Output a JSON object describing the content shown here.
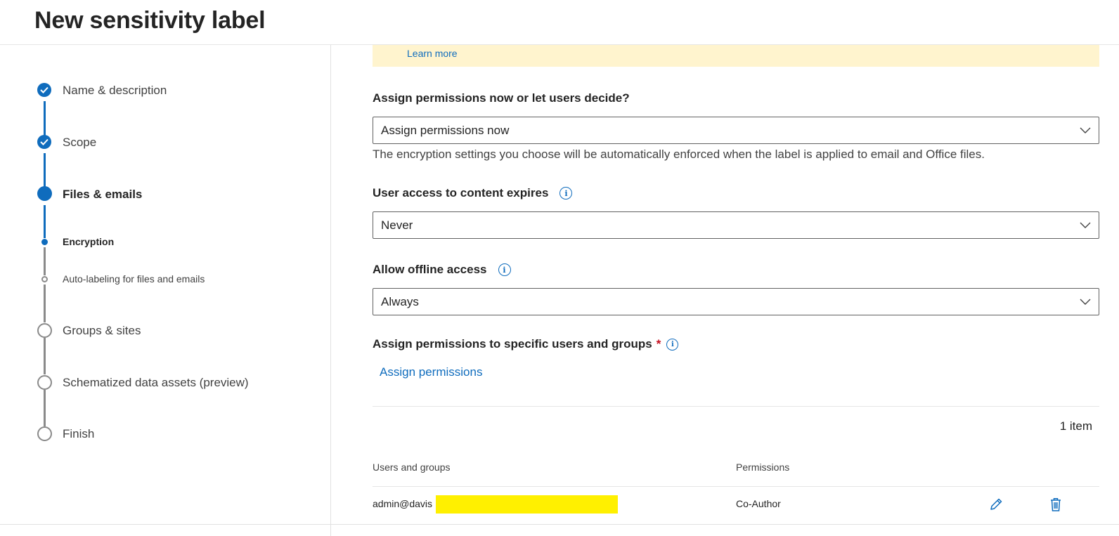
{
  "header": {
    "title": "New sensitivity label"
  },
  "steps": [
    {
      "label": "Name & description",
      "state": "completed",
      "icon": "check-icon"
    },
    {
      "label": "Scope",
      "state": "completed",
      "icon": "check-icon"
    },
    {
      "label": "Files & emails",
      "state": "current"
    },
    {
      "label": "Encryption",
      "state": "current-substep"
    },
    {
      "label": "Auto-labeling for files and emails",
      "state": "pending-substep"
    },
    {
      "label": "Groups & sites",
      "state": "pending"
    },
    {
      "label": "Schematized data assets (preview)",
      "state": "pending"
    },
    {
      "label": "Finish",
      "state": "pending"
    }
  ],
  "banner": {
    "link": "Learn more",
    "color": "#fff4ce"
  },
  "assign_mode": {
    "label": "Assign permissions now or let users decide?",
    "value": "Assign permissions now",
    "help": "The encryption settings you choose will be automatically enforced when the label is applied to email and Office files."
  },
  "expiry": {
    "label": "User access to content expires",
    "value": "Never"
  },
  "offline": {
    "label": "Allow offline access",
    "value": "Always"
  },
  "specific_permissions": {
    "label": "Assign permissions to specific users and groups",
    "required_mark": "*",
    "action": "Assign permissions"
  },
  "table": {
    "count": "1 item",
    "columns": [
      "Users and groups",
      "Permissions"
    ],
    "rows": [
      {
        "user": "admin@davis",
        "permission": "Co-Author",
        "actions": [
          "edit-icon",
          "delete-icon"
        ]
      }
    ]
  },
  "colors": {
    "accent": "#0f6cbd",
    "required": "#c50f1f",
    "redaction": "#fff000"
  }
}
